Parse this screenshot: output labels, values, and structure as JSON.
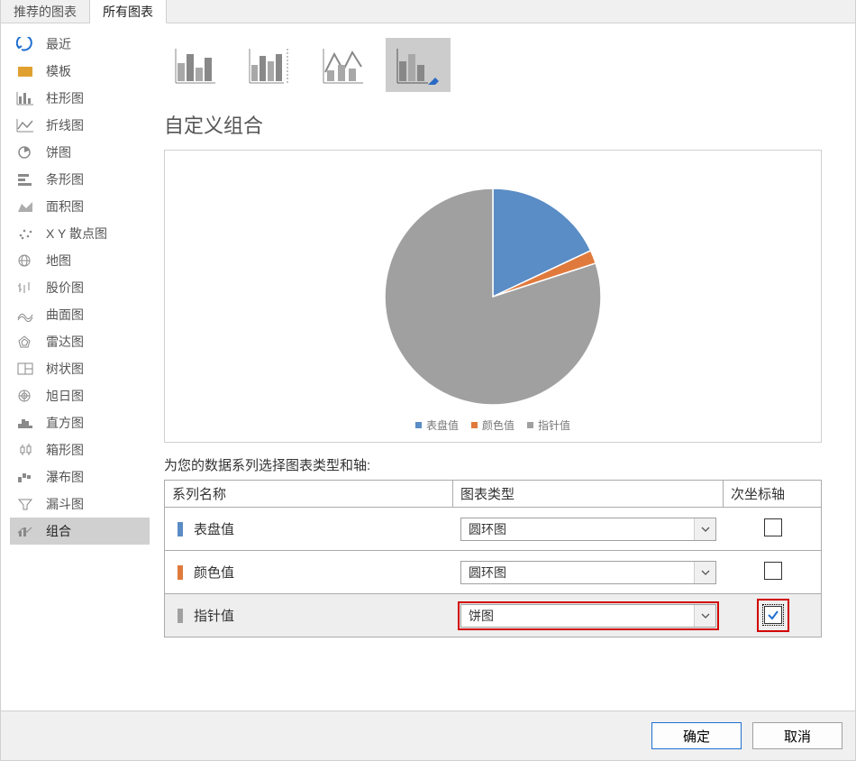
{
  "tabs": {
    "recommended": "推荐的图表",
    "all": "所有图表"
  },
  "sidebar": {
    "items": [
      {
        "label": "最近",
        "icon": "recent"
      },
      {
        "label": "模板",
        "icon": "template"
      },
      {
        "label": "柱形图",
        "icon": "column"
      },
      {
        "label": "折线图",
        "icon": "line"
      },
      {
        "label": "饼图",
        "icon": "pie"
      },
      {
        "label": "条形图",
        "icon": "bar"
      },
      {
        "label": "面积图",
        "icon": "area"
      },
      {
        "label": "X Y 散点图",
        "icon": "scatter"
      },
      {
        "label": "地图",
        "icon": "map"
      },
      {
        "label": "股价图",
        "icon": "stock"
      },
      {
        "label": "曲面图",
        "icon": "surface"
      },
      {
        "label": "雷达图",
        "icon": "radar"
      },
      {
        "label": "树状图",
        "icon": "treemap"
      },
      {
        "label": "旭日图",
        "icon": "sunburst"
      },
      {
        "label": "直方图",
        "icon": "histogram"
      },
      {
        "label": "箱形图",
        "icon": "box"
      },
      {
        "label": "瀑布图",
        "icon": "waterfall"
      },
      {
        "label": "漏斗图",
        "icon": "funnel"
      },
      {
        "label": "组合",
        "icon": "combo"
      }
    ],
    "selected_index": 18
  },
  "section_title": "自定义组合",
  "chart_data": {
    "type": "pie",
    "title": "",
    "series": [
      {
        "name": "表盘值",
        "value": 18,
        "color": "#5a8cc5"
      },
      {
        "name": "颜色值",
        "value": 2,
        "color": "#e07a3c"
      },
      {
        "name": "指针值",
        "value": 80,
        "color": "#a0a0a0"
      }
    ]
  },
  "series_section_label": "为您的数据系列选择图表类型和轴:",
  "series_table": {
    "headers": {
      "name": "系列名称",
      "type": "图表类型",
      "axis": "次坐标轴"
    },
    "rows": [
      {
        "color": "#5a8cc5",
        "name": "表盘值",
        "type": "圆环图",
        "secondary_axis": false,
        "highlight_type": false,
        "highlight_axis": false
      },
      {
        "color": "#e07a3c",
        "name": "颜色值",
        "type": "圆环图",
        "secondary_axis": false,
        "highlight_type": false,
        "highlight_axis": false
      },
      {
        "color": "#a0a0a0",
        "name": "指针值",
        "type": "饼图",
        "secondary_axis": true,
        "highlight_type": true,
        "highlight_axis": true,
        "row_highlight": true
      }
    ]
  },
  "footer": {
    "ok": "确定",
    "cancel": "取消"
  }
}
